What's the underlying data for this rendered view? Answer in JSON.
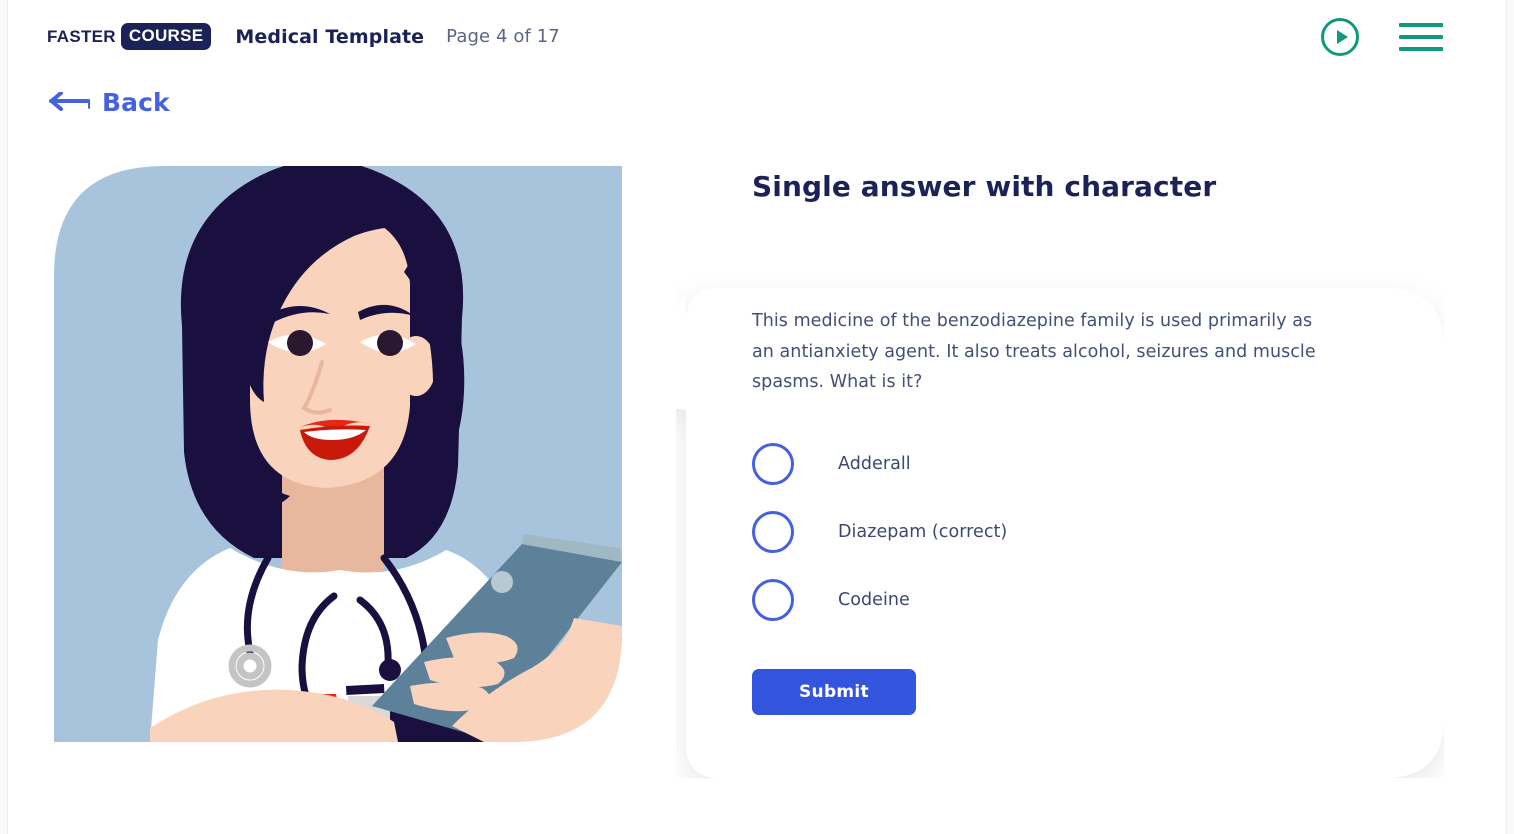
{
  "header": {
    "logo_primary": "FASTER",
    "logo_secondary": "COURSE",
    "template_title": "Medical Template",
    "page_counter": "Page 4 of 17",
    "play_icon": "play-circle-icon",
    "menu_icon": "hamburger-menu-icon",
    "accent_color": "#10997d"
  },
  "navigation": {
    "back_label": "Back",
    "back_icon": "arrow-left-icon",
    "back_color": "#4461e0"
  },
  "illustration": {
    "alt": "female-doctor-with-tablet-illustration",
    "background_color": "#a8c4dd",
    "hair_color": "#1a1040",
    "skin_color": "#f9d3bb",
    "coat_color": "#ffffff",
    "tablet_color": "#5d8199",
    "lips_color": "#e52713"
  },
  "main": {
    "title": "Single answer with character",
    "question": "This medicine of the benzodiazepine family is used primarily as an antianxiety agent. It also treats alcohol, seizures and muscle spasms. What is it?",
    "options": [
      {
        "label": "Adderall",
        "selected": false
      },
      {
        "label": "Diazepam (correct)",
        "selected": false
      },
      {
        "label": "Codeine",
        "selected": false
      }
    ],
    "submit_label": "Submit",
    "submit_color": "#3355dd",
    "title_color": "#1b2257"
  }
}
